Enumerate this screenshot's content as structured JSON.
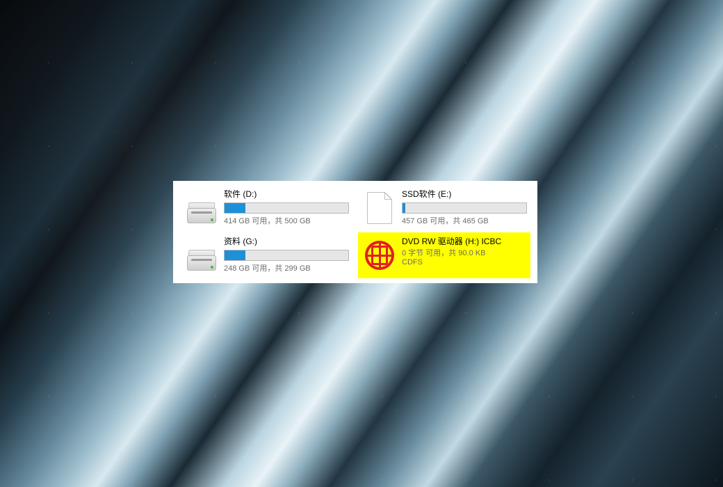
{
  "drives": [
    {
      "id": "d",
      "name": "软件 (D:)",
      "status": "414 GB 可用，共 500 GB",
      "used_pct": 17,
      "icon": "hdd",
      "has_bar": true,
      "highlighted": false
    },
    {
      "id": "e",
      "name": "SSD软件 (E:)",
      "status": "457 GB 可用，共 465 GB",
      "used_pct": 2,
      "icon": "page",
      "has_bar": true,
      "highlighted": false
    },
    {
      "id": "g",
      "name": "资料 (G:)",
      "status": "248 GB 可用，共 299 GB",
      "used_pct": 17,
      "icon": "hdd",
      "has_bar": true,
      "highlighted": false
    },
    {
      "id": "h",
      "name": "DVD RW 驱动器 (H:) ICBC",
      "status": "0 字节 可用，共 90.0 KB",
      "status2": "CDFS",
      "icon": "icbc",
      "has_bar": false,
      "highlighted": true
    }
  ]
}
